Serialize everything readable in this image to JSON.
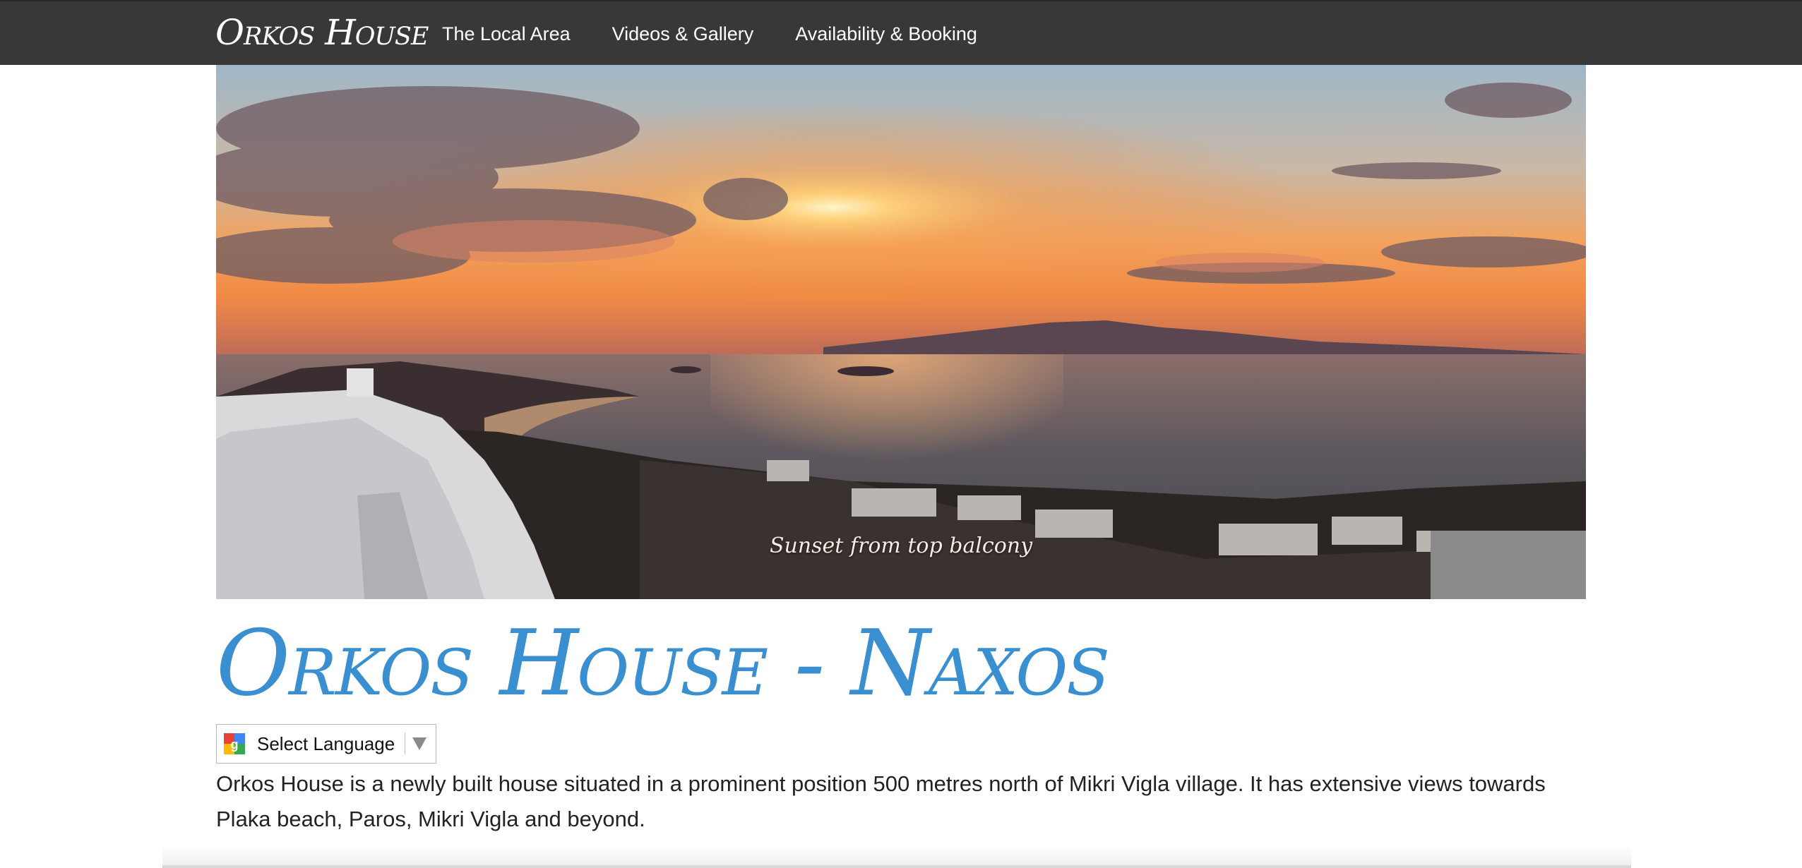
{
  "navbar": {
    "brand": "Orkos House",
    "links": [
      {
        "label": "The Local Area"
      },
      {
        "label": "Videos & Gallery"
      },
      {
        "label": "Availability & Booking"
      }
    ]
  },
  "hero": {
    "caption": "Sunset from top balcony"
  },
  "page": {
    "title": "Orkos House - Naxos"
  },
  "translate": {
    "label": "Select Language"
  },
  "content": {
    "intro": "Orkos House is a newly built house situated in a prominent position 500 metres north of Mikri Vigla village. It has extensive views towards Plaka beach, Paros, Mikri Vigla and beyond."
  },
  "colors": {
    "navbar_bg": "#383838",
    "title": "#3a8fd0"
  }
}
